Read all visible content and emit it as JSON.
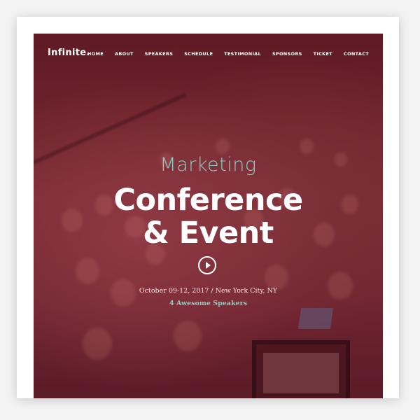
{
  "brand": {
    "logo": "Infinite."
  },
  "nav": {
    "items": [
      {
        "label": "HOME"
      },
      {
        "label": "ABOUT"
      },
      {
        "label": "SPEAKERS"
      },
      {
        "label": "SCHEDULE"
      },
      {
        "label": "TESTIMONIAL"
      },
      {
        "label": "SPONSORS"
      },
      {
        "label": "TICKET"
      },
      {
        "label": "CONTACT"
      }
    ]
  },
  "hero": {
    "subtitle": "Marketing",
    "title_line1": "Conference",
    "title_line2": "& Event",
    "play_icon": "play-icon",
    "date_location": "October 09-12, 2017 / New York City, NY",
    "speakers_link": "4 Awesome Speakers"
  },
  "colors": {
    "overlay": "#6e2430",
    "accent": "#7fd3c4",
    "text": "#ffffff"
  }
}
